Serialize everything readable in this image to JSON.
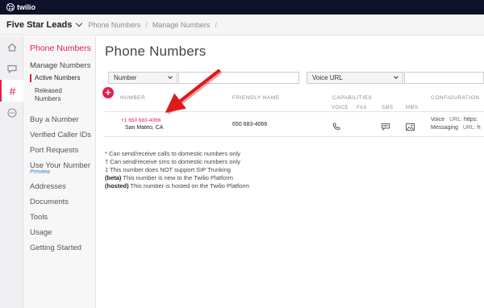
{
  "topbar": {
    "logo_text": "twilio",
    "bg_color": "#0d122b"
  },
  "breadcrumb": {
    "account": "Five Star Leads",
    "items": [
      "Phone Numbers",
      "Manage Numbers"
    ],
    "separator": "/"
  },
  "rail": {
    "icons": [
      "home-icon",
      "chat-bubble-icon",
      "hash-icon",
      "more-icon"
    ],
    "active_glyph": "#"
  },
  "sidenav": {
    "title": "Phone Numbers",
    "section": "Manage Numbers",
    "sub_items": [
      "Active Numbers",
      "Released Numbers"
    ],
    "items": [
      "Buy a Number",
      "Verified Caller IDs",
      "Port Requests",
      "Use Your Number",
      "Addresses",
      "Documents",
      "Tools",
      "Usage",
      "Getting Started"
    ],
    "preview_label": "Preview"
  },
  "main": {
    "title": "Phone Numbers",
    "filter1": {
      "label": "Number"
    },
    "filter2": {
      "label": "Voice URL"
    },
    "add_glyph": "+",
    "columns": {
      "number": "NUMBER",
      "friendly": "FRIENDLY NAME",
      "capabilities": "CAPABILITIES",
      "voice": "VOICE",
      "fax": "FAX",
      "sms": "SMS",
      "mms": "MMS",
      "configuration": "CONFIGURATION"
    },
    "row": {
      "number": "+1  650 683-4066",
      "location": "San Mateo, CA",
      "friendly_name": "650 683-4066",
      "config_voice": "Voice",
      "config_voice_key": "URL:",
      "config_voice_val": "https:",
      "config_messaging": "Messaging",
      "config_messaging_key": "URL:",
      "config_messaging_val": "h"
    },
    "notes": [
      {
        "bold": "",
        "text": "* Can send/receive calls to domestic numbers only"
      },
      {
        "bold": "",
        "text": "† Can send/receive sms to domestic numbers only"
      },
      {
        "bold": "",
        "text": "‡ This number does NOT support SIP Trunking"
      },
      {
        "bold": "(beta)",
        "text": " This number is new to the Twilio Platform"
      },
      {
        "bold": "(hosted)",
        "text": " This number is hosted on the Twilio Platform"
      }
    ]
  },
  "colors": {
    "accent": "#e31e4a",
    "arrow": "#e0191f"
  }
}
